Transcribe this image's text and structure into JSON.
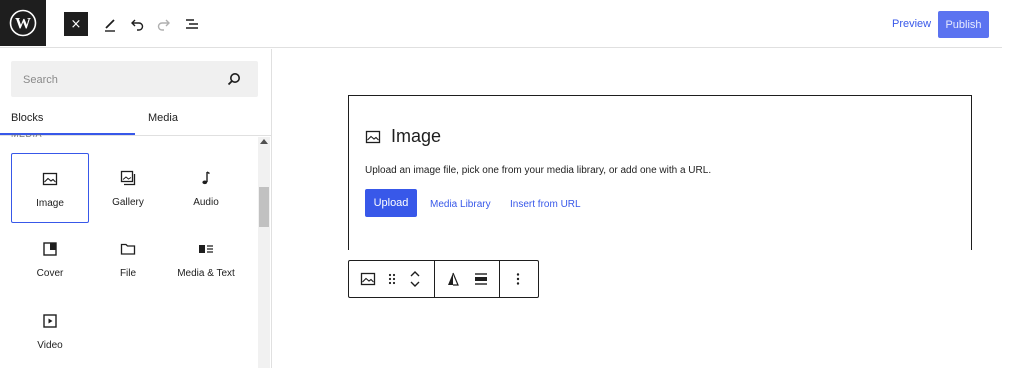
{
  "topbar": {
    "preview_label": "Preview",
    "publish_label": "Publish",
    "close_glyph": "×",
    "icons": [
      "wordpress-logo",
      "close-icon",
      "pen-icon",
      "undo-icon",
      "redo-icon",
      "list-view-icon"
    ]
  },
  "sidebar": {
    "search_placeholder": "Search",
    "tabs": [
      {
        "label": "Blocks",
        "active": true
      },
      {
        "label": "Media",
        "active": false
      }
    ],
    "category": "Media",
    "blocks": [
      {
        "label": "Image",
        "icon": "image-icon",
        "selected": true
      },
      {
        "label": "Gallery",
        "icon": "gallery-icon",
        "selected": false
      },
      {
        "label": "Audio",
        "icon": "audio-icon",
        "selected": false
      },
      {
        "label": "Cover",
        "icon": "cover-icon",
        "selected": false
      },
      {
        "label": "File",
        "icon": "file-icon",
        "selected": false
      },
      {
        "label": "Media & Text",
        "icon": "media-text-icon",
        "selected": false
      },
      {
        "label": "Video",
        "icon": "video-icon",
        "selected": false
      }
    ]
  },
  "image_block": {
    "title": "Image",
    "description": "Upload an image file, pick one from your media library, or add one with a URL.",
    "upload_label": "Upload",
    "media_library_label": "Media Library",
    "insert_url_label": "Insert from URL"
  },
  "block_toolbar": {
    "icons": [
      "image-icon",
      "drag-handle-icon",
      "move-up-down-icon",
      "align-icon",
      "align-wide-icon",
      "more-options-icon"
    ]
  },
  "colors": {
    "accent": "#3858e9",
    "publish_bg": "#5b73f0",
    "dark": "#1e1e1e",
    "border": "#e0e0e0",
    "search_bg": "#f0f0f0"
  }
}
